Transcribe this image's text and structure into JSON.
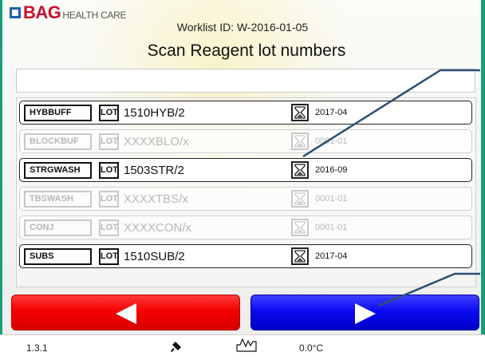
{
  "header": {
    "brand": "BAG",
    "brand_sub": "HEALTH CARE",
    "worklist": "Worklist ID: W-2016-01-05",
    "title": "Scan Reagent lot numbers"
  },
  "scan_input": {
    "value": ""
  },
  "reagents": [
    {
      "code": "HYBBUFF",
      "lot_label": "LOT",
      "lot_number": "1510HYB/2",
      "expiry": "2017-04",
      "enabled": true
    },
    {
      "code": "BLOCKBUF",
      "lot_label": "LOT",
      "lot_number": "XXXXBLO/x",
      "expiry": "0001-01",
      "enabled": false
    },
    {
      "code": "STRGWASH",
      "lot_label": "LOT",
      "lot_number": "1503STR/2",
      "expiry": "2016-09",
      "enabled": true
    },
    {
      "code": "TBSWASH",
      "lot_label": "LOT",
      "lot_number": "XXXXTBS/x",
      "expiry": "0001-01",
      "enabled": false
    },
    {
      "code": "CONJ",
      "lot_label": "LOT",
      "lot_number": "XXXXCON/x",
      "expiry": "0001-01",
      "enabled": false
    },
    {
      "code": "SUBS",
      "lot_label": "LOT",
      "lot_number": "1510SUB/2",
      "expiry": "2017-04",
      "enabled": true
    }
  ],
  "icons": {
    "expiry": "hourglass-icon",
    "back": "arrow-left-icon",
    "next": "arrow-right-icon",
    "connection": "plug-icon",
    "signal": "waveform-icon"
  },
  "colors": {
    "back_button": "#f40000",
    "next_button": "#0b0bf2",
    "brand": "#c8102e",
    "logo_square": "#1d5fa8",
    "frame": "#15a07a"
  },
  "status_bar": {
    "version": "1.3.1",
    "temperature": "0.0°C"
  }
}
